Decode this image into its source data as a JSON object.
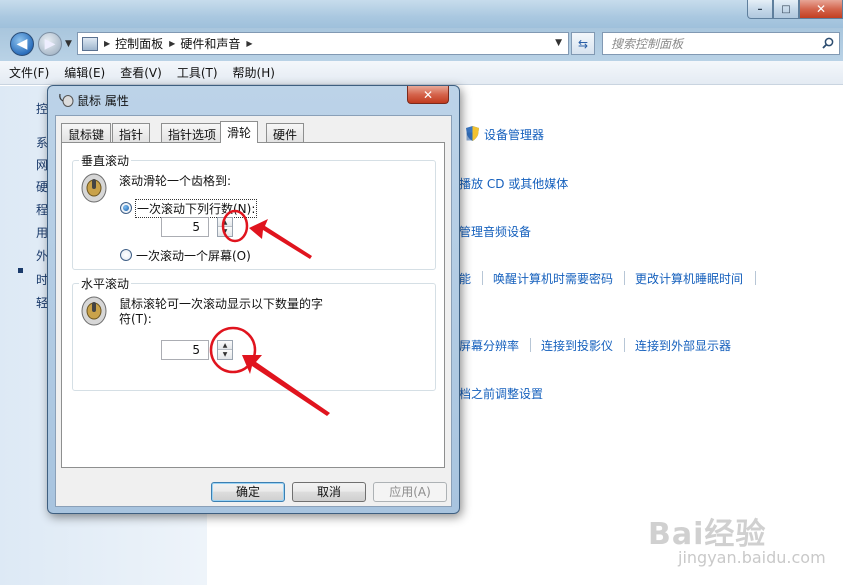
{
  "window": {
    "caption": {
      "minimize": "–",
      "maximize": "□",
      "close": "✕"
    }
  },
  "address": {
    "breadcrumbs": [
      "控制面板",
      "硬件和声音"
    ],
    "search_placeholder": "搜索控制面板"
  },
  "menu": [
    "文件(F)",
    "编辑(E)",
    "查看(V)",
    "工具(T)",
    "帮助(H)"
  ],
  "left_nav": {
    "items": [
      "控",
      "系",
      "网",
      "硬",
      "程",
      "用",
      "外",
      "时",
      "轻"
    ],
    "selected_index": 3
  },
  "main_links": {
    "row1": [
      "设备管理器"
    ],
    "row2": [
      "播放 CD 或其他媒体"
    ],
    "row3": [
      "管理音频设备"
    ],
    "row4": [
      "能",
      "唤醒计算机时需要密码",
      "更改计算机睡眠时间"
    ],
    "row5": [
      "屏幕分辨率",
      "连接到投影仪",
      "连接到外部显示器"
    ],
    "row6": [
      "档之前调整设置"
    ]
  },
  "dialog": {
    "title": "鼠标 属性",
    "close": "✕",
    "tabs": [
      "鼠标键",
      "指针",
      "指针选项",
      "滑轮",
      "硬件"
    ],
    "active_tab": "滑轮",
    "vertical": {
      "group_title": "垂直滚动",
      "description": "滚动滑轮一个齿格到:",
      "option_lines": "一次滚动下列行数(N):",
      "option_screen": "一次滚动一个屏幕(O)",
      "selected_option": "option_lines",
      "lines_value": "5"
    },
    "horizontal": {
      "group_title": "水平滚动",
      "description_line1": "鼠标滚轮可一次滚动显示以下数量的字",
      "description_line2": "符(T):",
      "chars_value": "5"
    },
    "buttons": {
      "ok": "确定",
      "cancel": "取消",
      "apply": "应用(A)"
    }
  },
  "annotation_color": "#e0141e",
  "watermark": {
    "brand": "Bai经验",
    "url": "jingyan.baidu.com"
  }
}
